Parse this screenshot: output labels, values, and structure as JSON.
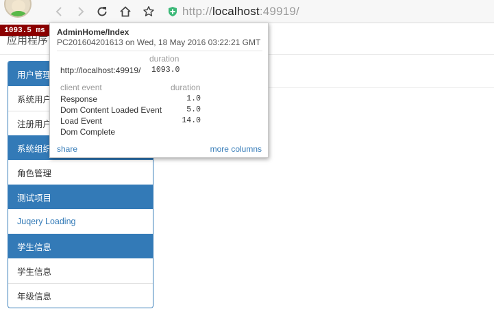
{
  "browser": {
    "url_prefix": "http://",
    "url_host": "localhost",
    "url_suffix": ":49919/",
    "icons": [
      "avatar",
      "back-arrow-icon",
      "forward-arrow-icon",
      "reload-icon",
      "home-icon",
      "bookmark-star-icon",
      "shield-icon"
    ]
  },
  "page": {
    "app_title": "应用程序"
  },
  "menu": {
    "groups": [
      {
        "header": "用户管理",
        "items": [
          {
            "label": "系统用户"
          },
          {
            "label": "注册用户"
          }
        ]
      },
      {
        "header": "系统组织",
        "items": [
          {
            "label": "角色管理"
          }
        ]
      },
      {
        "header": "测试项目",
        "items": [
          {
            "label": "Juqery Loading"
          }
        ]
      },
      {
        "header": "学生信息",
        "items": [
          {
            "label": "学生信息"
          },
          {
            "label": "年级信息"
          }
        ]
      }
    ]
  },
  "profiler": {
    "badge": "1093.5 ms",
    "title": "AdminHome/Index",
    "machine": "PC201604201613 on Wed, 18 May 2016 03:22:21 GMT",
    "duration_header": "duration",
    "request_url": "http://localhost:49919/",
    "request_duration": "1093.0",
    "client_event_header": "client event",
    "client_duration_header": "duration",
    "events": [
      {
        "name": "Response",
        "duration": "1.0"
      },
      {
        "name": "Dom Content Loaded Event",
        "duration": "5.0"
      },
      {
        "name": "Load Event",
        "duration": "14.0"
      },
      {
        "name": "Dom Complete",
        "duration": ""
      }
    ],
    "share_label": "share",
    "more_columns_label": "more columns"
  },
  "colors": {
    "primary": "#337ab7",
    "badge_bg": "#8b0000",
    "shield": "#3cb878"
  }
}
